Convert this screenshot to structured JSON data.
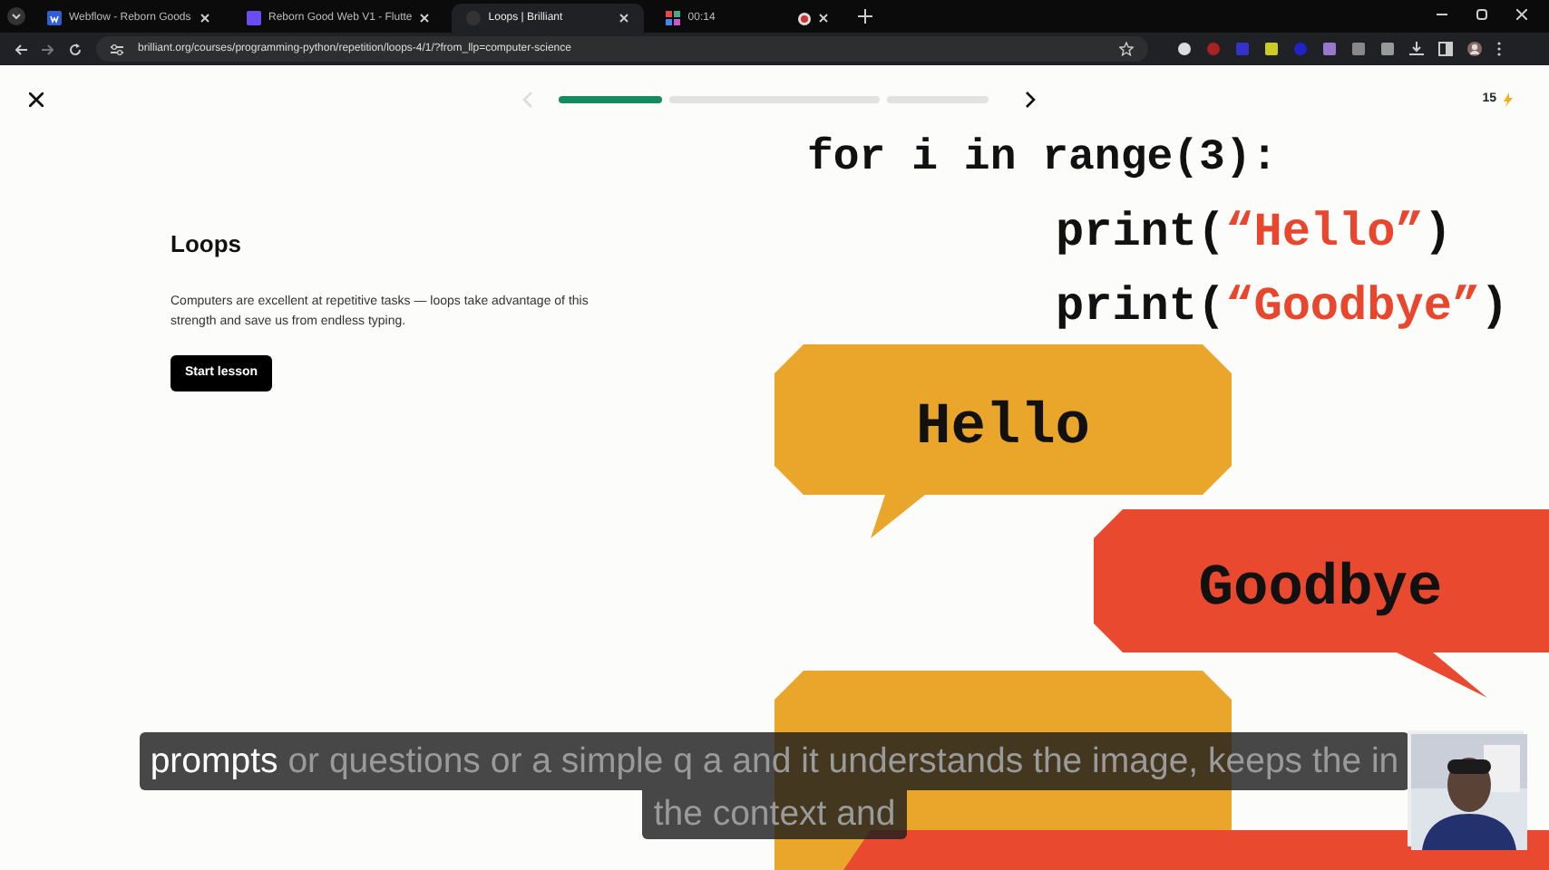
{
  "browser": {
    "tabs": [
      {
        "title": "Webflow - Reborn Goods",
        "selected": false,
        "kind": "webflow"
      },
      {
        "title": "Reborn Good Web V1 - Flutte",
        "selected": false,
        "kind": "flutter"
      },
      {
        "title": "Loops | Brilliant",
        "selected": true,
        "kind": "brilliant"
      },
      {
        "title": "00:14",
        "selected": false,
        "kind": "recording"
      }
    ],
    "address": "brilliant.org/courses/programming-python/repetition/loops-4/1/?from_llp=computer-science"
  },
  "lesson_bar": {
    "prev_disabled": true,
    "segments": [
      {
        "level": 1
      },
      {
        "level": 0
      },
      {
        "level": 0
      }
    ],
    "score": "15"
  },
  "intro": {
    "title": "Loops",
    "text": "Computers are excellent at repetitive tasks — loops take advantage of this strength and save us from endless typing.",
    "button": "Start lesson"
  },
  "illustration": {
    "code": [
      [
        {
          "text": "for i in range(3):",
          "kind": "code"
        }
      ],
      [
        {
          "text": "print(",
          "kind": "code"
        },
        {
          "text": "“Hello”",
          "kind": "string"
        },
        {
          "text": ")",
          "kind": "code"
        }
      ],
      [
        {
          "text": "print(",
          "kind": "code"
        },
        {
          "text": "“Goodbye”",
          "kind": "string"
        },
        {
          "text": ")",
          "kind": "code"
        }
      ]
    ],
    "bubbles": [
      {
        "text": "Hello",
        "color": "#e9a62a"
      },
      {
        "text": "Goodbye",
        "color": "#e9492f"
      }
    ]
  },
  "captions": [
    [
      {
        "text": "prompts",
        "spoken": true
      },
      {
        "text": "or questions or a simple q a and it understands the image, keeps the in",
        "spoken": false
      }
    ],
    [
      {
        "text": "the context and",
        "spoken": false
      }
    ]
  ]
}
